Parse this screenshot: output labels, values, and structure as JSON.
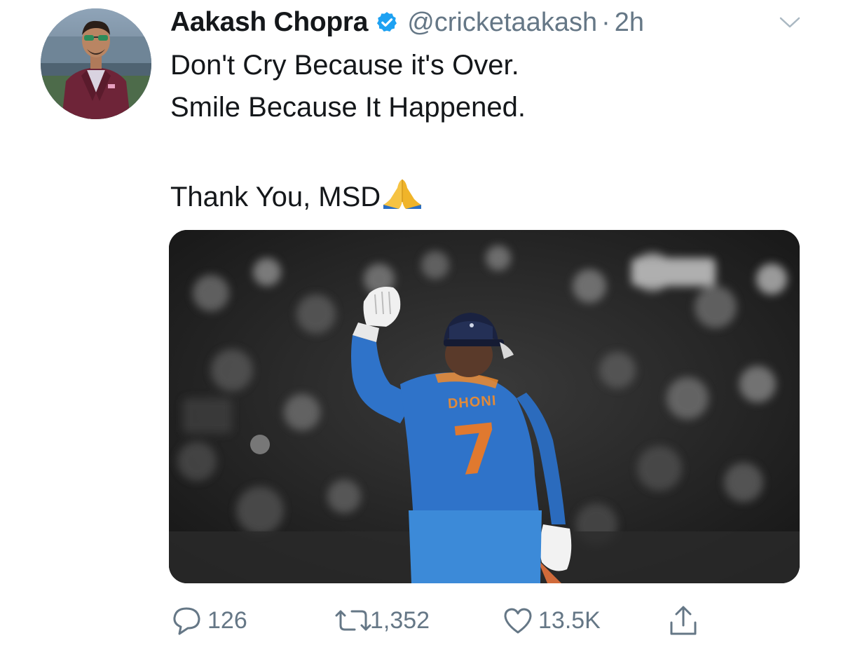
{
  "author": {
    "display_name": "Aakash Chopra",
    "handle": "@cricketaakash",
    "separator": "·",
    "time": "2h",
    "verified": true,
    "verified_color": "#1da1f2"
  },
  "tweet": {
    "lines": [
      "Don't Cry Because it's Over.",
      "Smile Because It Happened.",
      "Thank You, MSD"
    ],
    "emoji": "folded-hands",
    "media": {
      "jersey_name": "DHONI",
      "jersey_number": "7"
    }
  },
  "actions": {
    "reply_count": "126",
    "retweet_count": "1,352",
    "like_count": "13.5K"
  },
  "icons": {
    "reply": "reply-bubble-icon",
    "retweet": "retweet-icon",
    "like": "heart-icon",
    "share": "share-icon",
    "more": "chevron-down-icon"
  },
  "colors": {
    "text": "#14171a",
    "secondary": "#657786",
    "jersey_blue": "#2f73c9",
    "jersey_orange": "#e0792f"
  }
}
